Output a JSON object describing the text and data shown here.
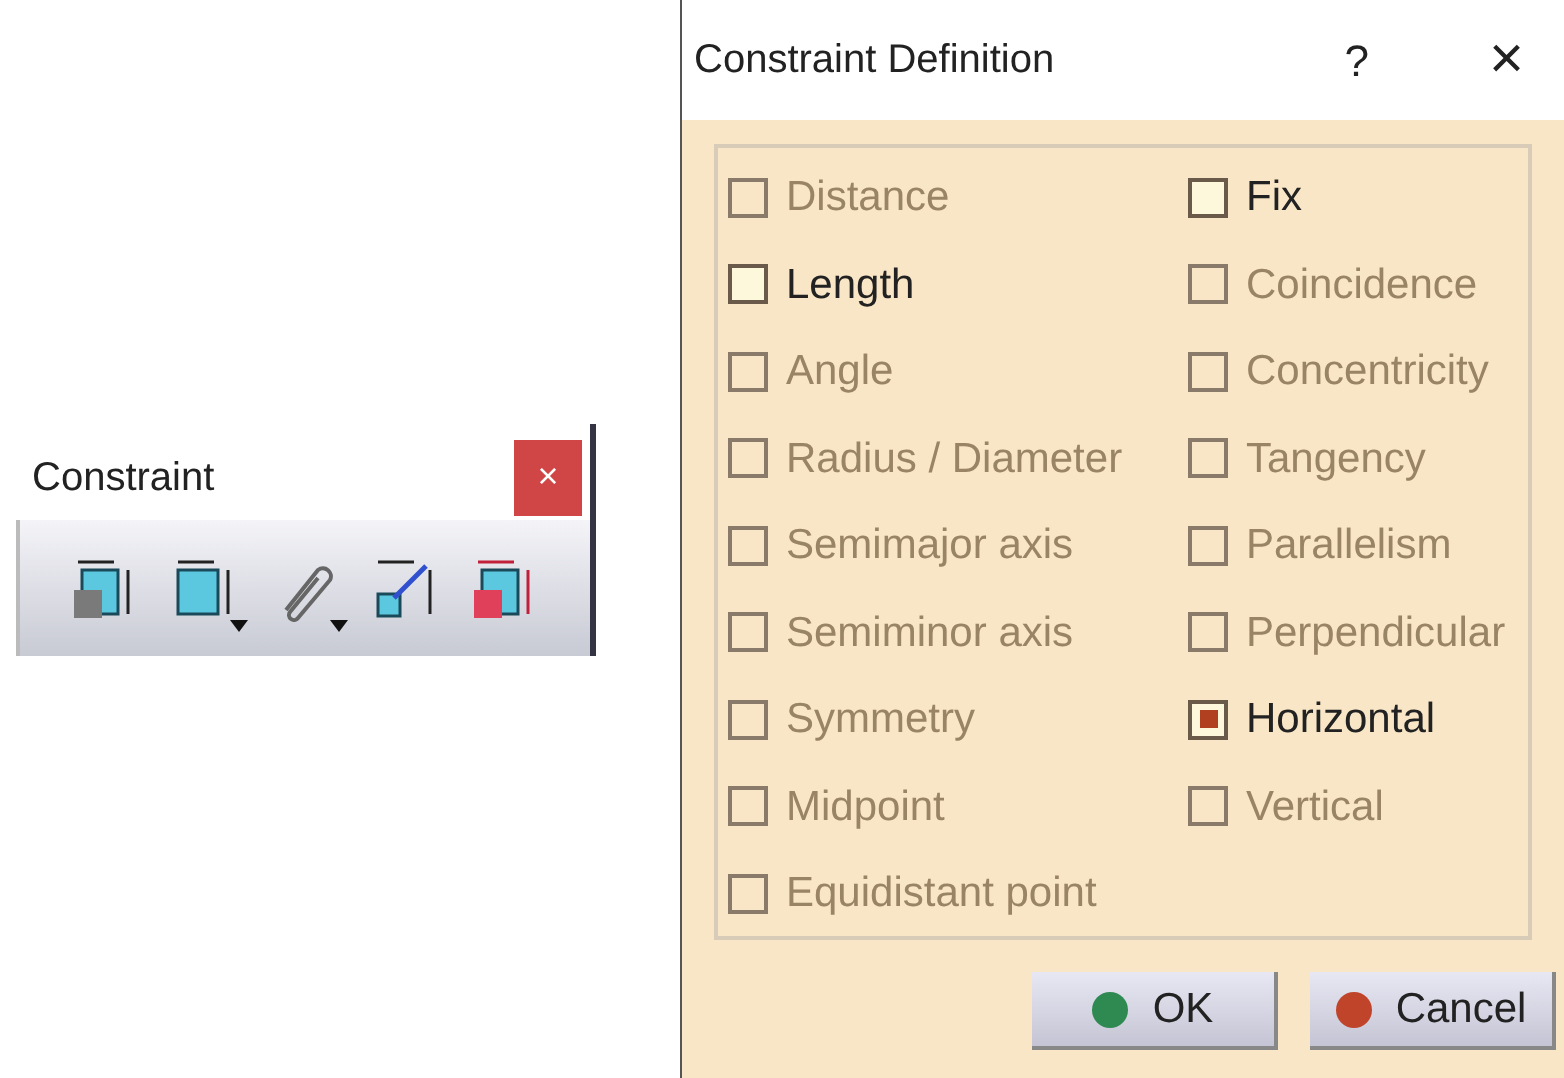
{
  "toolbar": {
    "title": "Constraint",
    "close": "×",
    "tools": [
      {
        "kind": "dimension",
        "dropdown": false
      },
      {
        "kind": "box",
        "dropdown": true
      },
      {
        "kind": "clip",
        "dropdown": true
      },
      {
        "kind": "auto",
        "dropdown": false
      },
      {
        "kind": "animate",
        "dropdown": false
      }
    ]
  },
  "dialog": {
    "title": "Constraint Definition",
    "help": "?",
    "close": "×",
    "columns": [
      [
        {
          "label": "Distance",
          "checked": false,
          "disabled": true
        },
        {
          "label": "Length",
          "checked": false,
          "disabled": false
        },
        {
          "label": "Angle",
          "checked": false,
          "disabled": true
        },
        {
          "label": "Radius / Diameter",
          "checked": false,
          "disabled": true
        },
        {
          "label": "Semimajor axis",
          "checked": false,
          "disabled": true
        },
        {
          "label": "Semiminor axis",
          "checked": false,
          "disabled": true
        },
        {
          "label": "Symmetry",
          "checked": false,
          "disabled": true
        },
        {
          "label": "Midpoint",
          "checked": false,
          "disabled": true
        },
        {
          "label": "Equidistant point",
          "checked": false,
          "disabled": true
        }
      ],
      [
        {
          "label": "Fix",
          "checked": false,
          "disabled": false
        },
        {
          "label": "Coincidence",
          "checked": false,
          "disabled": true
        },
        {
          "label": "Concentricity",
          "checked": false,
          "disabled": true
        },
        {
          "label": "Tangency",
          "checked": false,
          "disabled": true
        },
        {
          "label": "Parallelism",
          "checked": false,
          "disabled": true
        },
        {
          "label": "Perpendicular",
          "checked": false,
          "disabled": true
        },
        {
          "label": "Horizontal",
          "checked": true,
          "disabled": false
        },
        {
          "label": "Vertical",
          "checked": false,
          "disabled": true
        }
      ]
    ],
    "buttons": [
      {
        "label": "OK",
        "kind": "ok"
      },
      {
        "label": "Cancel",
        "kind": "cancel"
      }
    ]
  }
}
